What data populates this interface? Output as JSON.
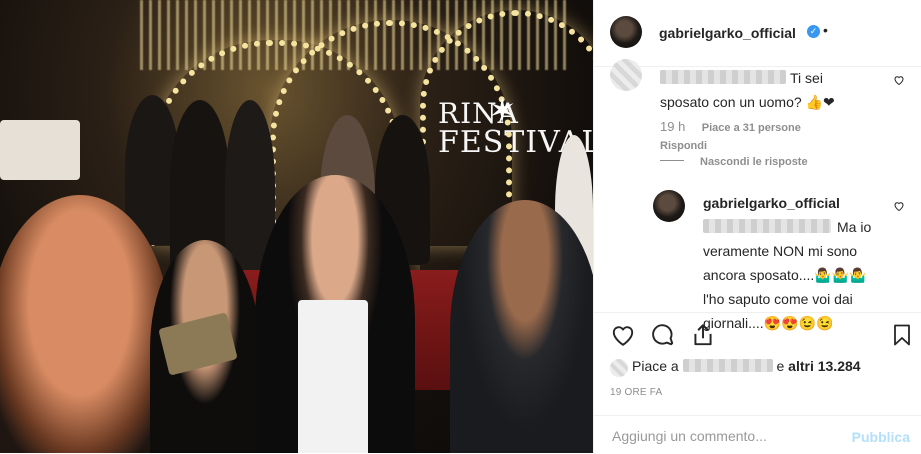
{
  "photo": {
    "sign_line1": "RINA",
    "sign_line2": "FESTIVAL"
  },
  "header": {
    "username": "gabrielgarko_official",
    "verified": true,
    "separator": "•"
  },
  "comment": {
    "text_tail": "Ti sei",
    "text_line2": "sposato con un uomo? 👍❤",
    "time": "19 h",
    "likes": "Piace a 31 persone",
    "reply": "Rispondi",
    "hide_replies": "Nascondi le risposte"
  },
  "reply": {
    "username": "gabrielgarko_official",
    "text_tail": "Ma io",
    "text_rest": "veramente NON mi sono ancora sposato....🤷‍♂️🤷‍♂️🤷‍♂️ l'ho saputo come voi dai giornali....😍😍😉😉"
  },
  "post": {
    "likes_prefix": "Piace a",
    "likes_suffix_and": "e",
    "likes_others": "altri 13.284",
    "time_ago": "19 ORE FA"
  },
  "add_comment": {
    "placeholder": "Aggiungi un commento...",
    "post_label": "Pubblica"
  },
  "colors": {
    "verified": "#3897f0",
    "post_button_disabled": "#b2dffc",
    "meta_gray": "#8e8e8e"
  },
  "icons": [
    "verified-badge-icon",
    "heart-icon",
    "comment-icon",
    "share-icon",
    "bookmark-icon"
  ]
}
